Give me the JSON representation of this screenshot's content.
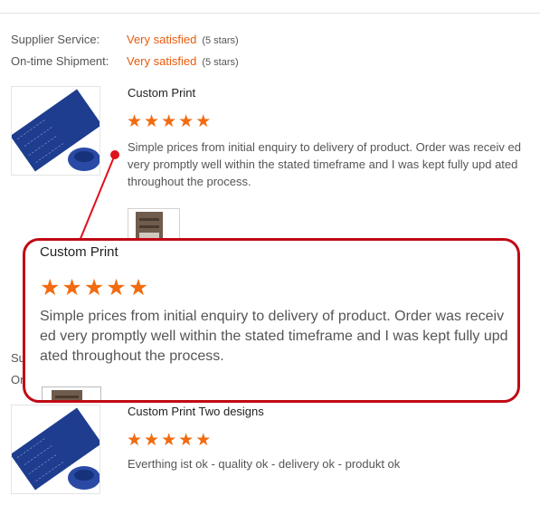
{
  "supplier_ratings": {
    "service_label": "Supplier Service:",
    "service_value": "Very satisfied",
    "service_stars": "(5 stars)",
    "shipment_label": "On-time Shipment:",
    "shipment_value": "Very satisfied",
    "shipment_stars": "(5 stars)"
  },
  "reviews": [
    {
      "title": "Custom Print",
      "rating": 5,
      "text": "Simple prices from initial enquiry to delivery of product.  Order was receiv ed very promptly well within the stated timeframe and I was kept fully upd ated throughout the process.",
      "product_image": "blue-neck-gaiter-image",
      "has_photo": true
    },
    {
      "title": "Custom Print Two designs",
      "rating": 5,
      "text": "Everthing ist ok - quality ok - delivery ok - produkt ok",
      "product_image": "blue-neck-gaiter-image"
    }
  ],
  "partial_labels": {
    "line1": "Su",
    "line2": "On"
  },
  "callout": {
    "title": "Custom Print",
    "rating": 5,
    "text": "Simple prices from initial enquiry to delivery of product.  Order was receiv ed very promptly well within the stated timeframe and I was kept fully upd ated throughout the process.",
    "border_color": "#c00914"
  },
  "colors": {
    "accent": "#e85b0c",
    "star": "#f26b10",
    "highlight": "#c00914"
  }
}
